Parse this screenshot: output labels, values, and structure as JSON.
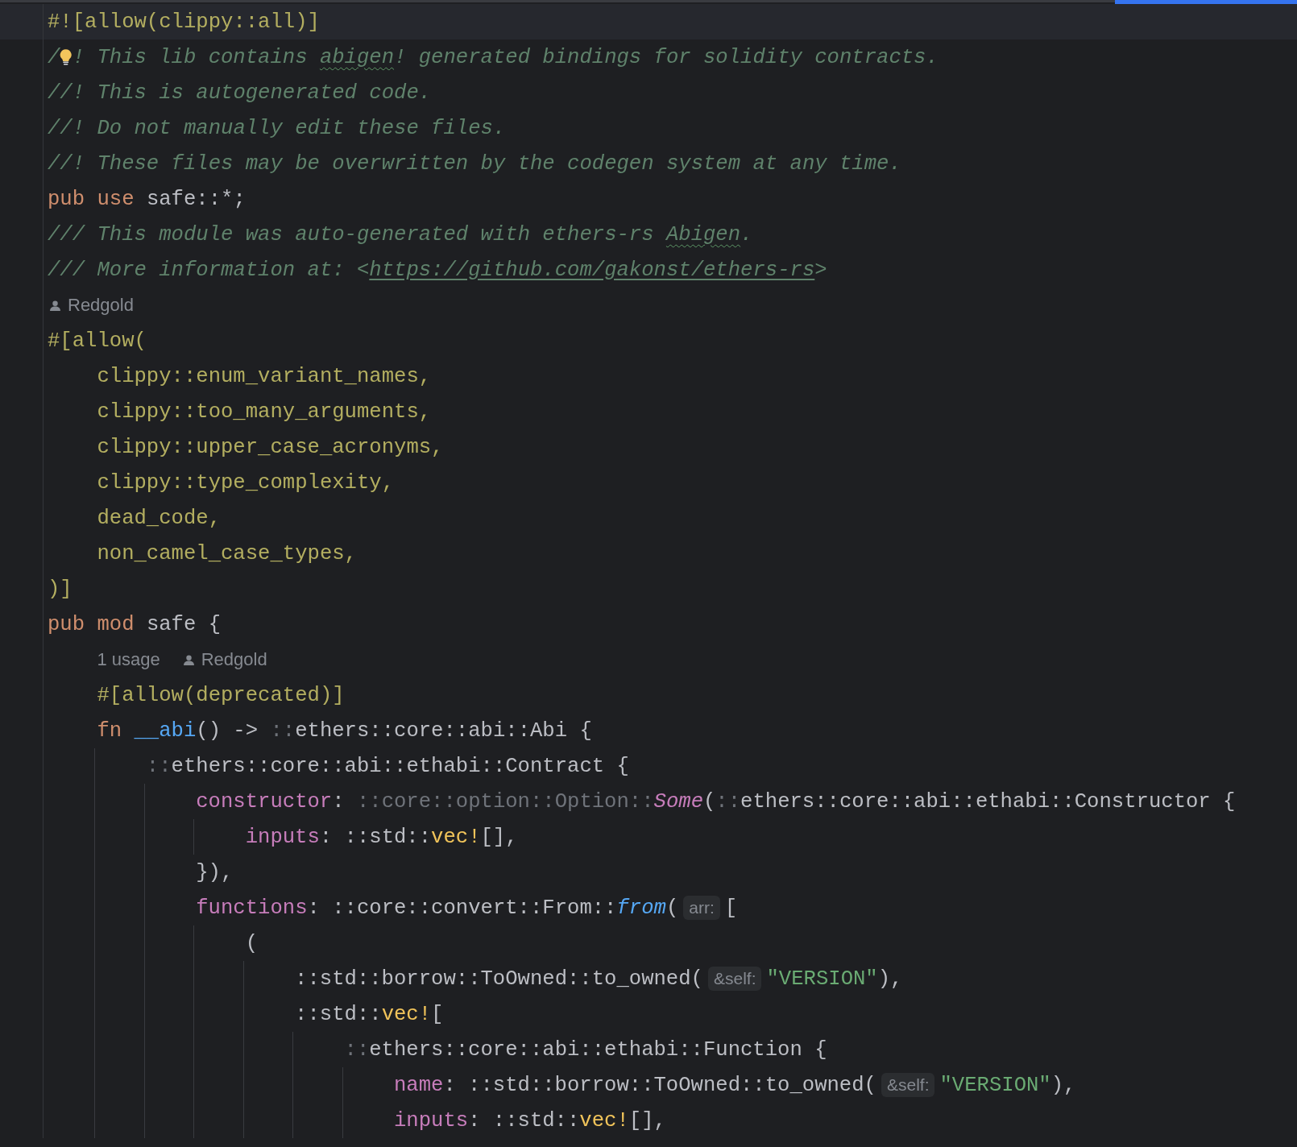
{
  "editor": {
    "lines": [
      {
        "kind": "code",
        "current": true,
        "tokens": [
          {
            "kind": "attr",
            "t": "#![allow(clippy::all)]"
          }
        ]
      },
      {
        "kind": "code",
        "current": false,
        "tokens": [
          {
            "kind": "comment",
            "t": "/"
          },
          {
            "kind": "bulb"
          },
          {
            "kind": "comment",
            "t": "! This lib contains "
          },
          {
            "kind": "typo",
            "t": "abigen"
          },
          {
            "kind": "comment",
            "t": "! generated bindings for solidity contracts."
          }
        ]
      },
      {
        "kind": "code",
        "current": false,
        "tokens": [
          {
            "kind": "comment",
            "t": "//! This is autogenerated code."
          }
        ]
      },
      {
        "kind": "code",
        "current": false,
        "tokens": [
          {
            "kind": "comment",
            "t": "//! Do not manually edit these files."
          }
        ]
      },
      {
        "kind": "code",
        "current": false,
        "tokens": [
          {
            "kind": "comment",
            "t": "//! These files may be overwritten by the codegen system at any time."
          }
        ]
      },
      {
        "kind": "code",
        "current": false,
        "tokens": [
          {
            "kind": "kw",
            "t": "pub use "
          },
          {
            "kind": "plain",
            "t": "safe::*;"
          }
        ]
      },
      {
        "kind": "code",
        "current": false,
        "tokens": [
          {
            "kind": "comment",
            "t": "/// This module was auto-generated with ethers-rs "
          },
          {
            "kind": "typo",
            "t": "Abigen"
          },
          {
            "kind": "comment",
            "t": "."
          }
        ]
      },
      {
        "kind": "code",
        "current": false,
        "tokens": [
          {
            "kind": "comment",
            "t": "/// More information at: <"
          },
          {
            "kind": "link",
            "t": "https://github.com/gakonst/ethers-rs"
          },
          {
            "kind": "comment",
            "t": ">"
          }
        ]
      },
      {
        "kind": "hint",
        "current": false,
        "author": "Redgold"
      },
      {
        "kind": "code",
        "current": false,
        "tokens": [
          {
            "kind": "attr",
            "t": "#[allow("
          }
        ],
        "children": [
          {
            "kind": "code",
            "current": false,
            "tokens": [
              {
                "kind": "attr",
                "t": "clippy::enum_variant_names,"
              }
            ]
          },
          {
            "kind": "code",
            "current": false,
            "tokens": [
              {
                "kind": "attr",
                "t": "clippy::too_many_arguments,"
              }
            ]
          },
          {
            "kind": "code",
            "current": false,
            "tokens": [
              {
                "kind": "attr",
                "t": "clippy::upper_case_acronyms,"
              }
            ]
          },
          {
            "kind": "code",
            "current": false,
            "tokens": [
              {
                "kind": "attr",
                "t": "clippy::type_complexity,"
              }
            ]
          },
          {
            "kind": "code",
            "current": false,
            "tokens": [
              {
                "kind": "attr",
                "t": "dead_code,"
              }
            ]
          },
          {
            "kind": "code",
            "current": false,
            "tokens": [
              {
                "kind": "attr",
                "t": "non_camel_case_types,"
              }
            ]
          }
        ]
      },
      {
        "kind": "code",
        "current": false,
        "tokens": [
          {
            "kind": "attr",
            "t": ")]"
          }
        ]
      },
      {
        "kind": "code",
        "current": false,
        "tokens": [
          {
            "kind": "kw",
            "t": "pub mod "
          },
          {
            "kind": "plain",
            "t": "safe {"
          }
        ],
        "children": [
          {
            "kind": "hint",
            "current": false,
            "usages": "1 usage",
            "author": "Redgold"
          },
          {
            "kind": "code",
            "current": false,
            "tokens": [
              {
                "kind": "attr",
                "t": "#[allow(deprecated)]"
              }
            ]
          },
          {
            "kind": "code",
            "current": false,
            "tokens": [
              {
                "kind": "kw",
                "t": "fn "
              },
              {
                "kind": "fn",
                "t": "__abi"
              },
              {
                "kind": "plain",
                "t": "() -> "
              },
              {
                "kind": "dim",
                "t": "::"
              },
              {
                "kind": "plain",
                "t": "ethers::core::abi::Abi {"
              }
            ],
            "children": [
              {
                "kind": "code",
                "current": false,
                "tokens": [
                  {
                    "kind": "dim",
                    "t": "::"
                  },
                  {
                    "kind": "plain",
                    "t": "ethers::core::abi::ethabi::Contract {"
                  }
                ],
                "children": [
                  {
                    "kind": "code",
                    "current": false,
                    "tokens": [
                      {
                        "kind": "field",
                        "t": "constructor"
                      },
                      {
                        "kind": "plain",
                        "t": ": "
                      },
                      {
                        "kind": "dim",
                        "t": "::core::option::Option::"
                      },
                      {
                        "kind": "variant",
                        "t": "Some"
                      },
                      {
                        "kind": "plain",
                        "t": "("
                      },
                      {
                        "kind": "dim",
                        "t": "::"
                      },
                      {
                        "kind": "plain",
                        "t": "ethers::core::abi::ethabi::Constructor {"
                      }
                    ],
                    "children": [
                      {
                        "kind": "code",
                        "current": false,
                        "tokens": [
                          {
                            "kind": "field",
                            "t": "inputs"
                          },
                          {
                            "kind": "plain",
                            "t": ": ::std::"
                          },
                          {
                            "kind": "macro",
                            "t": "vec!"
                          },
                          {
                            "kind": "plain",
                            "t": "[],"
                          }
                        ]
                      }
                    ]
                  },
                  {
                    "kind": "code",
                    "current": false,
                    "tokens": [
                      {
                        "kind": "plain",
                        "t": "}),"
                      }
                    ]
                  },
                  {
                    "kind": "code",
                    "current": false,
                    "tokens": [
                      {
                        "kind": "field",
                        "t": "functions"
                      },
                      {
                        "kind": "plain",
                        "t": ": ::core::convert::From::"
                      },
                      {
                        "kind": "fn_italic",
                        "t": "from"
                      },
                      {
                        "kind": "plain",
                        "t": "("
                      },
                      {
                        "kind": "param",
                        "t": "arr:"
                      },
                      {
                        "kind": "plain",
                        "t": "["
                      }
                    ],
                    "children": [
                      {
                        "kind": "code",
                        "current": false,
                        "tokens": [
                          {
                            "kind": "plain",
                            "t": "("
                          }
                        ],
                        "children": [
                          {
                            "kind": "code",
                            "current": false,
                            "tokens": [
                              {
                                "kind": "plain",
                                "t": "::std::borrow::ToOwned::to_owned("
                              },
                              {
                                "kind": "param",
                                "t": "&self:"
                              },
                              {
                                "kind": "str",
                                "t": "\"VERSION\""
                              },
                              {
                                "kind": "plain",
                                "t": "),"
                              }
                            ]
                          },
                          {
                            "kind": "code",
                            "current": false,
                            "tokens": [
                              {
                                "kind": "plain",
                                "t": "::std::"
                              },
                              {
                                "kind": "macro",
                                "t": "vec!"
                              },
                              {
                                "kind": "plain",
                                "t": "["
                              }
                            ],
                            "children": [
                              {
                                "kind": "code",
                                "current": false,
                                "tokens": [
                                  {
                                    "kind": "dim",
                                    "t": "::"
                                  },
                                  {
                                    "kind": "plain",
                                    "t": "ethers::core::abi::ethabi::Function {"
                                  }
                                ],
                                "children": [
                                  {
                                    "kind": "code",
                                    "current": false,
                                    "tokens": [
                                      {
                                        "kind": "field",
                                        "t": "name"
                                      },
                                      {
                                        "kind": "plain",
                                        "t": ": ::std::borrow::ToOwned::to_owned("
                                      },
                                      {
                                        "kind": "param",
                                        "t": "&self:"
                                      },
                                      {
                                        "kind": "str",
                                        "t": "\"VERSION\""
                                      },
                                      {
                                        "kind": "plain",
                                        "t": "),"
                                      }
                                    ]
                                  },
                                  {
                                    "kind": "code",
                                    "current": false,
                                    "tokens": [
                                      {
                                        "kind": "field",
                                        "t": "inputs"
                                      },
                                      {
                                        "kind": "plain",
                                        "t": ": ::std::"
                                      },
                                      {
                                        "kind": "macro",
                                        "t": "vec!"
                                      },
                                      {
                                        "kind": "plain",
                                        "t": "[],"
                                      }
                                    ]
                                  }
                                ]
                              }
                            ]
                          }
                        ]
                      }
                    ]
                  }
                ]
              }
            ]
          }
        ]
      }
    ]
  }
}
